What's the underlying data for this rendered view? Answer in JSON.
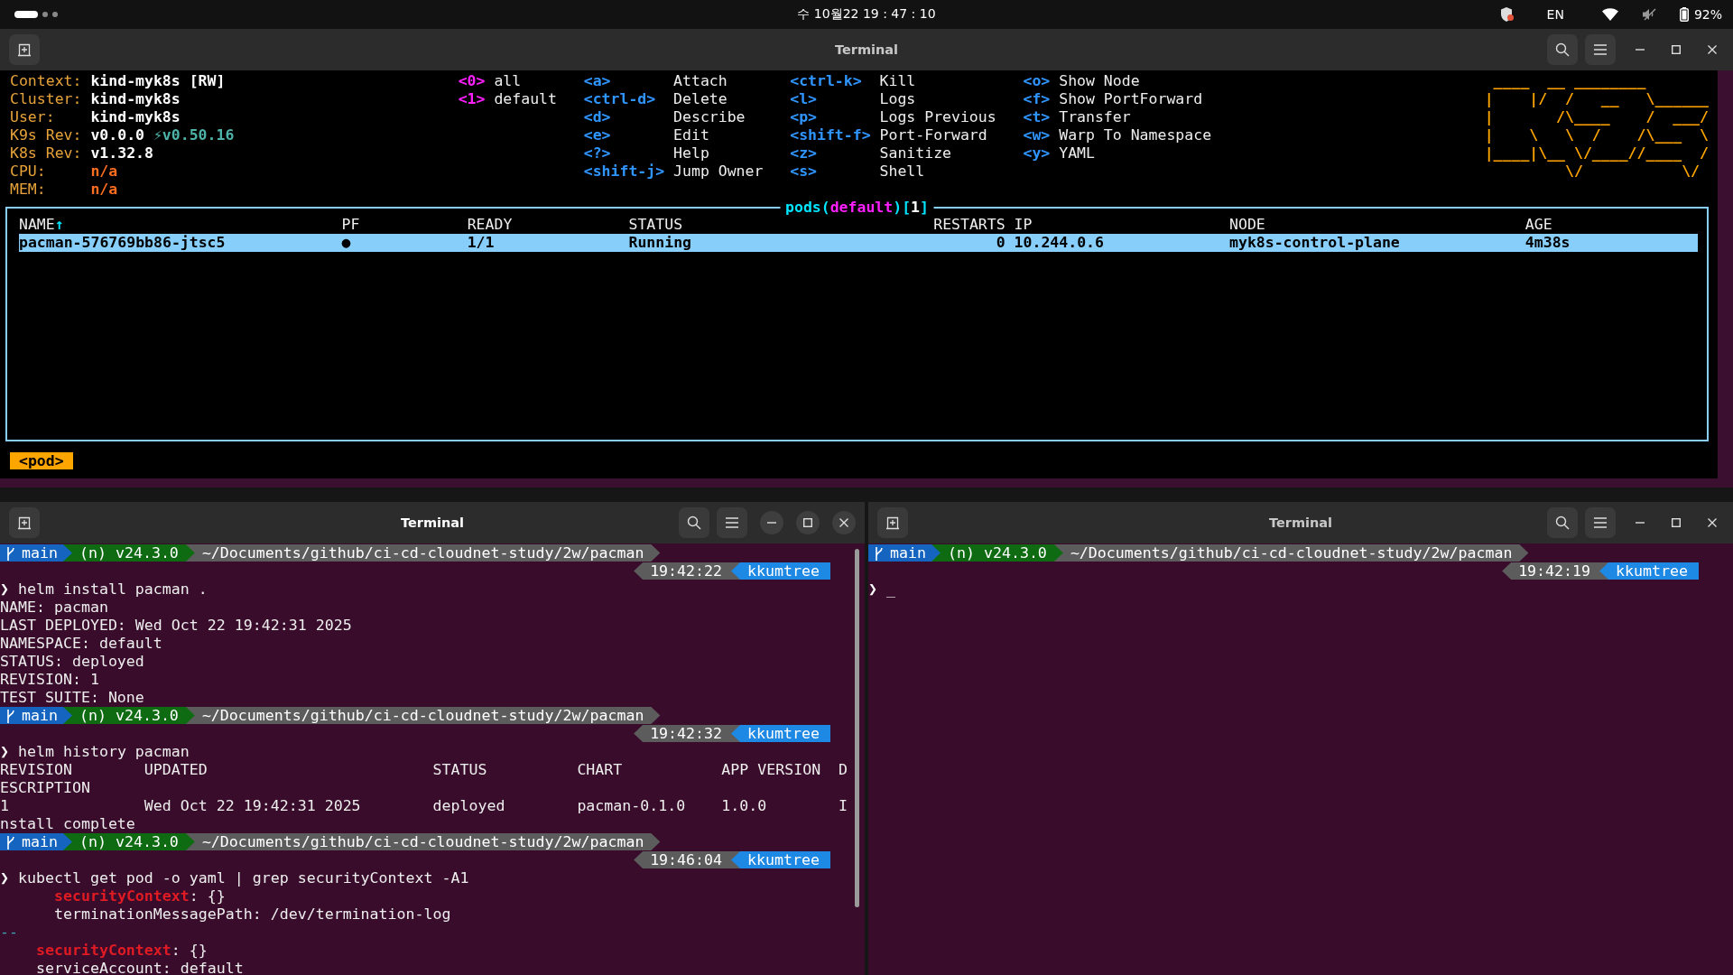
{
  "system_bar": {
    "clock": "수 10월22 19 : 47 : 10",
    "input_source": "EN",
    "battery": "92%"
  },
  "windows": [
    {
      "kind": "k9s",
      "title": "Terminal",
      "focused": false,
      "info": [
        {
          "label": "Context:",
          "value": "kind-myk8s [RW]",
          "kind": "plain"
        },
        {
          "label": "Cluster:",
          "value": "kind-myk8s",
          "kind": "plain"
        },
        {
          "label": "User:",
          "value": "kind-myk8s",
          "kind": "plain"
        },
        {
          "label": "K9s Rev:",
          "value": "v0.0.0",
          "extra": "⚡v0.50.16",
          "kind": "plain"
        },
        {
          "label": "K8s Rev:",
          "value": "v1.32.8",
          "kind": "plain"
        },
        {
          "label": "CPU:",
          "value": "n/a",
          "kind": "metric"
        },
        {
          "label": "MEM:",
          "value": "n/a",
          "kind": "metric"
        }
      ],
      "namespaces": [
        {
          "key": "<0>",
          "name": "all"
        },
        {
          "key": "<1>",
          "name": "default"
        }
      ],
      "shortcut_columns": [
        [
          {
            "key": "<a>",
            "action": "Attach"
          },
          {
            "key": "<ctrl-d>",
            "action": "Delete"
          },
          {
            "key": "<d>",
            "action": "Describe"
          },
          {
            "key": "<e>",
            "action": "Edit"
          },
          {
            "key": "<?>",
            "action": "Help"
          },
          {
            "key": "<shift-j>",
            "action": "Jump Owner"
          }
        ],
        [
          {
            "key": "<ctrl-k>",
            "action": "Kill"
          },
          {
            "key": "<l>",
            "action": "Logs"
          },
          {
            "key": "<p>",
            "action": "Logs Previous"
          },
          {
            "key": "<shift-f>",
            "action": "Port-Forward"
          },
          {
            "key": "<z>",
            "action": "Sanitize"
          },
          {
            "key": "<s>",
            "action": "Shell"
          }
        ],
        [
          {
            "key": "<o>",
            "action": "Show Node"
          },
          {
            "key": "<f>",
            "action": "Show PortForward"
          },
          {
            "key": "<t>",
            "action": "Transfer"
          },
          {
            "key": "<w>",
            "action": "Warp To Namespace"
          },
          {
            "key": "<y>",
            "action": "YAML"
          }
        ]
      ],
      "logo_lines": [
        " ____  __ ________",
        "|    |/  /   __   \\______",
        "|       /\\____    /  ___/",
        "|    \\   \\  /    /\\___  \\",
        "|____|\\__ \\/____//____  /",
        "         \\/           \\/"
      ],
      "table": {
        "title_parts": [
          {
            "kind": "frame",
            "text": "pods("
          },
          {
            "kind": "namespace",
            "text": "default"
          },
          {
            "kind": "frame",
            "text": ")["
          },
          {
            "kind": "count",
            "text": "1"
          },
          {
            "kind": "frame",
            "text": "]"
          }
        ],
        "columns": [
          {
            "label": "NAME",
            "sort_mark": "↑",
            "kind": "text"
          },
          {
            "label": "PF",
            "kind": "text"
          },
          {
            "label": "READY",
            "kind": "text"
          },
          {
            "label": "STATUS",
            "kind": "text"
          },
          {
            "label": "RESTARTS",
            "kind": "numeric"
          },
          {
            "label": "IP",
            "kind": "text"
          },
          {
            "label": "NODE",
            "kind": "text"
          },
          {
            "label": "AGE",
            "kind": "text"
          }
        ],
        "rows": [
          {
            "selected": true,
            "cells": [
              "pacman-576769bb86-jtsc5",
              "●",
              "1/1",
              "Running",
              "0",
              "10.244.0.6",
              "myk8s-control-plane",
              "4m38s"
            ]
          }
        ]
      },
      "breadcrumb": "<pod>"
    },
    {
      "kind": "shell",
      "title": "Terminal",
      "focused": true,
      "scrollbar": true,
      "blocks": [
        {
          "prompt": {
            "branch": "main",
            "runtime": "(n) v24.3.0",
            "path": "~/Documents/github/ci-cd-cloudnet-study/2w/pacman",
            "time": "19:42:22",
            "user": "kkumtree"
          },
          "prompt_symbol": "❯",
          "command": "helm install pacman .",
          "output": [
            {
              "kind": "plain",
              "text": "NAME: pacman"
            },
            {
              "kind": "plain",
              "text": "LAST DEPLOYED: Wed Oct 22 19:42:31 2025"
            },
            {
              "kind": "plain",
              "text": "NAMESPACE: default"
            },
            {
              "kind": "plain",
              "text": "STATUS: deployed"
            },
            {
              "kind": "plain",
              "text": "REVISION: 1"
            },
            {
              "kind": "plain",
              "text": "TEST SUITE: None"
            }
          ]
        },
        {
          "prompt": {
            "branch": "main",
            "runtime": "(n) v24.3.0",
            "path": "~/Documents/github/ci-cd-cloudnet-study/2w/pacman",
            "time": "19:42:32",
            "user": "kkumtree"
          },
          "prompt_symbol": "❯",
          "command": "helm history pacman",
          "output": [
            {
              "kind": "plain",
              "text": "REVISION        UPDATED                         STATUS          CHART           APP VERSION  D"
            },
            {
              "kind": "plain",
              "text": "ESCRIPTION"
            },
            {
              "kind": "plain",
              "text": "1               Wed Oct 22 19:42:31 2025        deployed        pacman-0.1.0    1.0.0        I"
            },
            {
              "kind": "plain",
              "text": "nstall complete"
            }
          ]
        },
        {
          "prompt": {
            "branch": "main",
            "runtime": "(n) v24.3.0",
            "path": "~/Documents/github/ci-cd-cloudnet-study/2w/pacman",
            "time": "19:46:04",
            "user": "kkumtree"
          },
          "prompt_symbol": "❯",
          "command": "kubectl get pod -o yaml | grep securityContext -A1",
          "output": [
            {
              "kind": "plain",
              "text": "      **securityContext**: {}"
            },
            {
              "kind": "plain",
              "text": "      terminationMessagePath: /dev/termination-log"
            },
            {
              "kind": "separator",
              "text": "--"
            },
            {
              "kind": "plain",
              "text": "    **securityContext**: {}"
            },
            {
              "kind": "plain",
              "text": "    serviceAccount: default"
            }
          ]
        }
      ]
    },
    {
      "kind": "shell",
      "title": "Terminal",
      "focused": false,
      "scrollbar": false,
      "blocks": [
        {
          "prompt": {
            "branch": "main",
            "runtime": "(n) v24.3.0",
            "path": "~/Documents/github/ci-cd-cloudnet-study/2w/pacman",
            "time": "19:42:19",
            "user": "kkumtree"
          },
          "prompt_symbol": "❯",
          "cursor": "_"
        }
      ]
    }
  ]
}
